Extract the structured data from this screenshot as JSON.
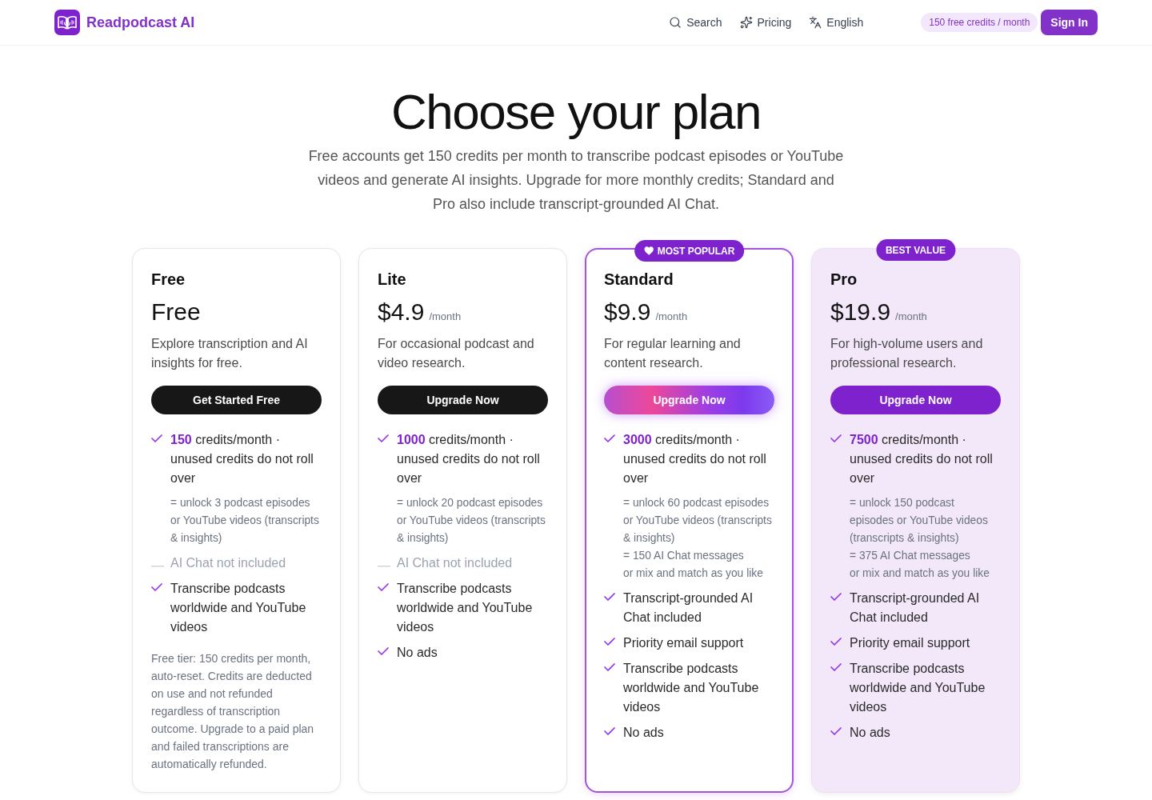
{
  "header": {
    "brand": "Readpodcast AI",
    "nav": [
      {
        "label": "Search",
        "kind": "search"
      },
      {
        "label": "Pricing",
        "kind": "pricing"
      },
      {
        "label": "English",
        "kind": "language"
      }
    ],
    "credits_badge": "150 free credits / month",
    "sign_in": "Sign In"
  },
  "hero": {
    "title": "Choose your plan",
    "subtitle_lines": [
      "Free accounts get 150 credits per month to transcribe podcast episodes or YouTube",
      "videos and generate AI insights. Upgrade for more monthly credits; Standard and",
      "Pro also include transcript-grounded AI Chat."
    ]
  },
  "plans": [
    {
      "name": "Free",
      "price": "Free",
      "description": "Explore transcription and AI insights for free.",
      "button": "Get Started Free",
      "features": [
        {
          "kind": "included",
          "text": "**150** credits/month · unused credits do not roll over",
          "notes": [
            "= unlock 3 podcast episodes or YouTube videos (transcripts & insights)"
          ]
        },
        {
          "kind": "excluded",
          "text": "AI Chat not included"
        },
        {
          "kind": "included",
          "text": "Transcribe podcasts worldwide and YouTube videos"
        }
      ],
      "footnote": "Free tier: 150 credits per month, auto-reset. Credits are deducted on use and not refunded regardless of transcription outcome. Upgrade to a paid plan and failed transcriptions are automatically refunded."
    },
    {
      "name": "Lite",
      "price": "$4.9",
      "period": "/month",
      "description": "For occasional podcast and video research.",
      "button": "Upgrade Now",
      "features": [
        {
          "kind": "included",
          "text": "**1000** credits/month · unused credits do not roll over",
          "notes": [
            "= unlock 20 podcast episodes or YouTube videos (transcripts & insights)"
          ]
        },
        {
          "kind": "excluded",
          "text": "AI Chat not included"
        },
        {
          "kind": "included",
          "text": "Transcribe podcasts worldwide and YouTube videos"
        },
        {
          "kind": "included",
          "text": "No ads"
        }
      ]
    },
    {
      "name": "Standard",
      "badge": {
        "label": "MOST POPULAR",
        "kind": "popular"
      },
      "price": "$9.9",
      "period": "/month",
      "description": "For regular learning and content research.",
      "button": "Upgrade Now",
      "features": [
        {
          "kind": "included",
          "text": "**3000** credits/month · unused credits do not roll over",
          "notes": [
            "= unlock 60 podcast episodes or YouTube videos (transcripts & insights)",
            "= 150 AI Chat messages",
            "or mix and match as you like"
          ]
        },
        {
          "kind": "included",
          "text": "Transcript-grounded AI Chat included"
        },
        {
          "kind": "included",
          "text": "Priority email support"
        },
        {
          "kind": "included",
          "text": "Transcribe podcasts worldwide and YouTube videos"
        },
        {
          "kind": "included",
          "text": "No ads"
        }
      ]
    },
    {
      "name": "Pro",
      "badge": {
        "label": "BEST VALUE",
        "kind": "value"
      },
      "price": "$19.9",
      "period": "/month",
      "description": "For high-volume users and professional research.",
      "button": "Upgrade Now",
      "features": [
        {
          "kind": "included",
          "text": "**7500** credits/month · unused credits do not roll over",
          "notes": [
            "= unlock 150 podcast episodes or YouTube videos (transcripts & insights)",
            "= 375 AI Chat messages",
            "or mix and match as you like"
          ]
        },
        {
          "kind": "included",
          "text": "Transcript-grounded AI Chat included"
        },
        {
          "kind": "included",
          "text": "Priority email support"
        },
        {
          "kind": "included",
          "text": "Transcribe podcasts worldwide and YouTube videos"
        },
        {
          "kind": "included",
          "text": "No ads"
        }
      ]
    }
  ]
}
